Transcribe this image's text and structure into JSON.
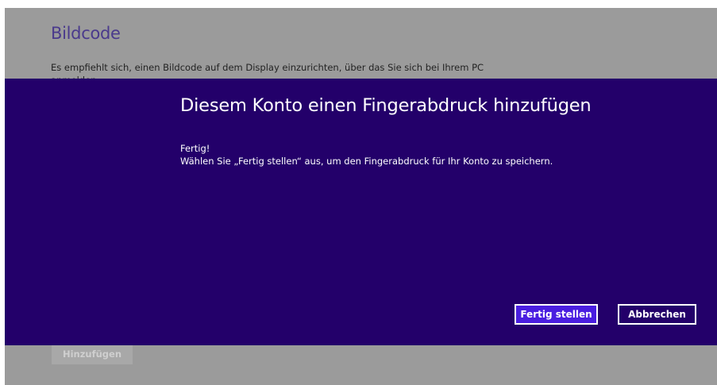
{
  "background": {
    "title": "Bildcode",
    "description_line1": "Es empfiehlt sich, einen Bildcode auf dem Display einzurichten, über das Sie sich bei Ihrem PC",
    "description_line2": "anmelden",
    "add_button_label": "Hinzufügen"
  },
  "dialog": {
    "title": "Diesem Konto einen Fingerabdruck hinzufügen",
    "status": "Fertig!",
    "message": "Wählen Sie „Fertig stellen“ aus, um den Fingerabdruck für Ihr Konto zu speichern.",
    "finish_label": "Fertig stellen",
    "cancel_label": "Abbrechen"
  },
  "colors": {
    "dialog_background": "#23006a",
    "primary_button": "#4a1ee0",
    "background_title": "#4a3a8c",
    "dimmed_page": "#9b9b9b"
  }
}
